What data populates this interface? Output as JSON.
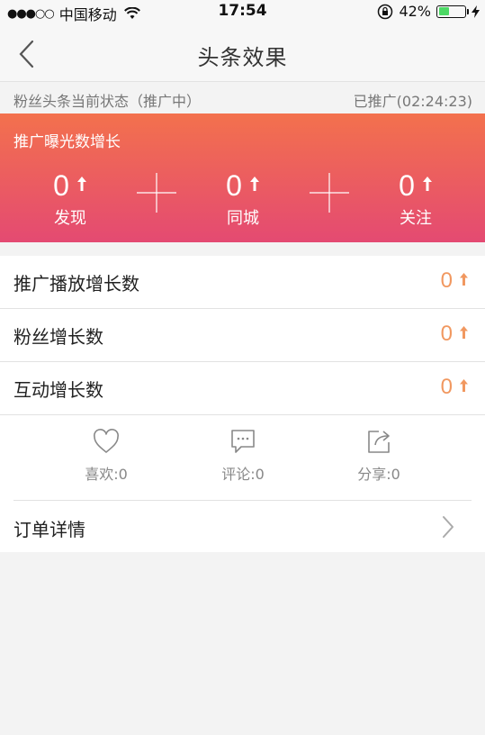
{
  "status_bar": {
    "signal": "●●●○○",
    "carrier": "中国移动",
    "time": "17:54",
    "battery_percent": "42%",
    "battery_level": 0.42,
    "battery_color": "#4cd964"
  },
  "nav": {
    "back_icon": "chevron-left-icon",
    "title": "头条效果"
  },
  "state": {
    "left": "粉丝头条当前状态（推广中）",
    "right": "已推广(02:24:23)"
  },
  "growth": {
    "title": "推广曝光数增长",
    "metrics": [
      {
        "value": "0",
        "label": "发现"
      },
      {
        "value": "0",
        "label": "同城"
      },
      {
        "value": "0",
        "label": "关注"
      }
    ],
    "gradient_top": "#f3714d",
    "gradient_bottom": "#e44a72"
  },
  "stats": [
    {
      "label": "推广播放增长数",
      "value": "0"
    },
    {
      "label": "粉丝增长数",
      "value": "0"
    },
    {
      "label": "互动增长数",
      "value": "0"
    }
  ],
  "stat_accent": "#f19860",
  "actions": [
    {
      "icon": "heart-icon",
      "label": "喜欢:0"
    },
    {
      "icon": "comment-icon",
      "label": "评论:0"
    },
    {
      "icon": "share-icon",
      "label": "分享:0"
    }
  ],
  "order": {
    "label": "订单详情",
    "icon": "chevron-right-icon"
  }
}
